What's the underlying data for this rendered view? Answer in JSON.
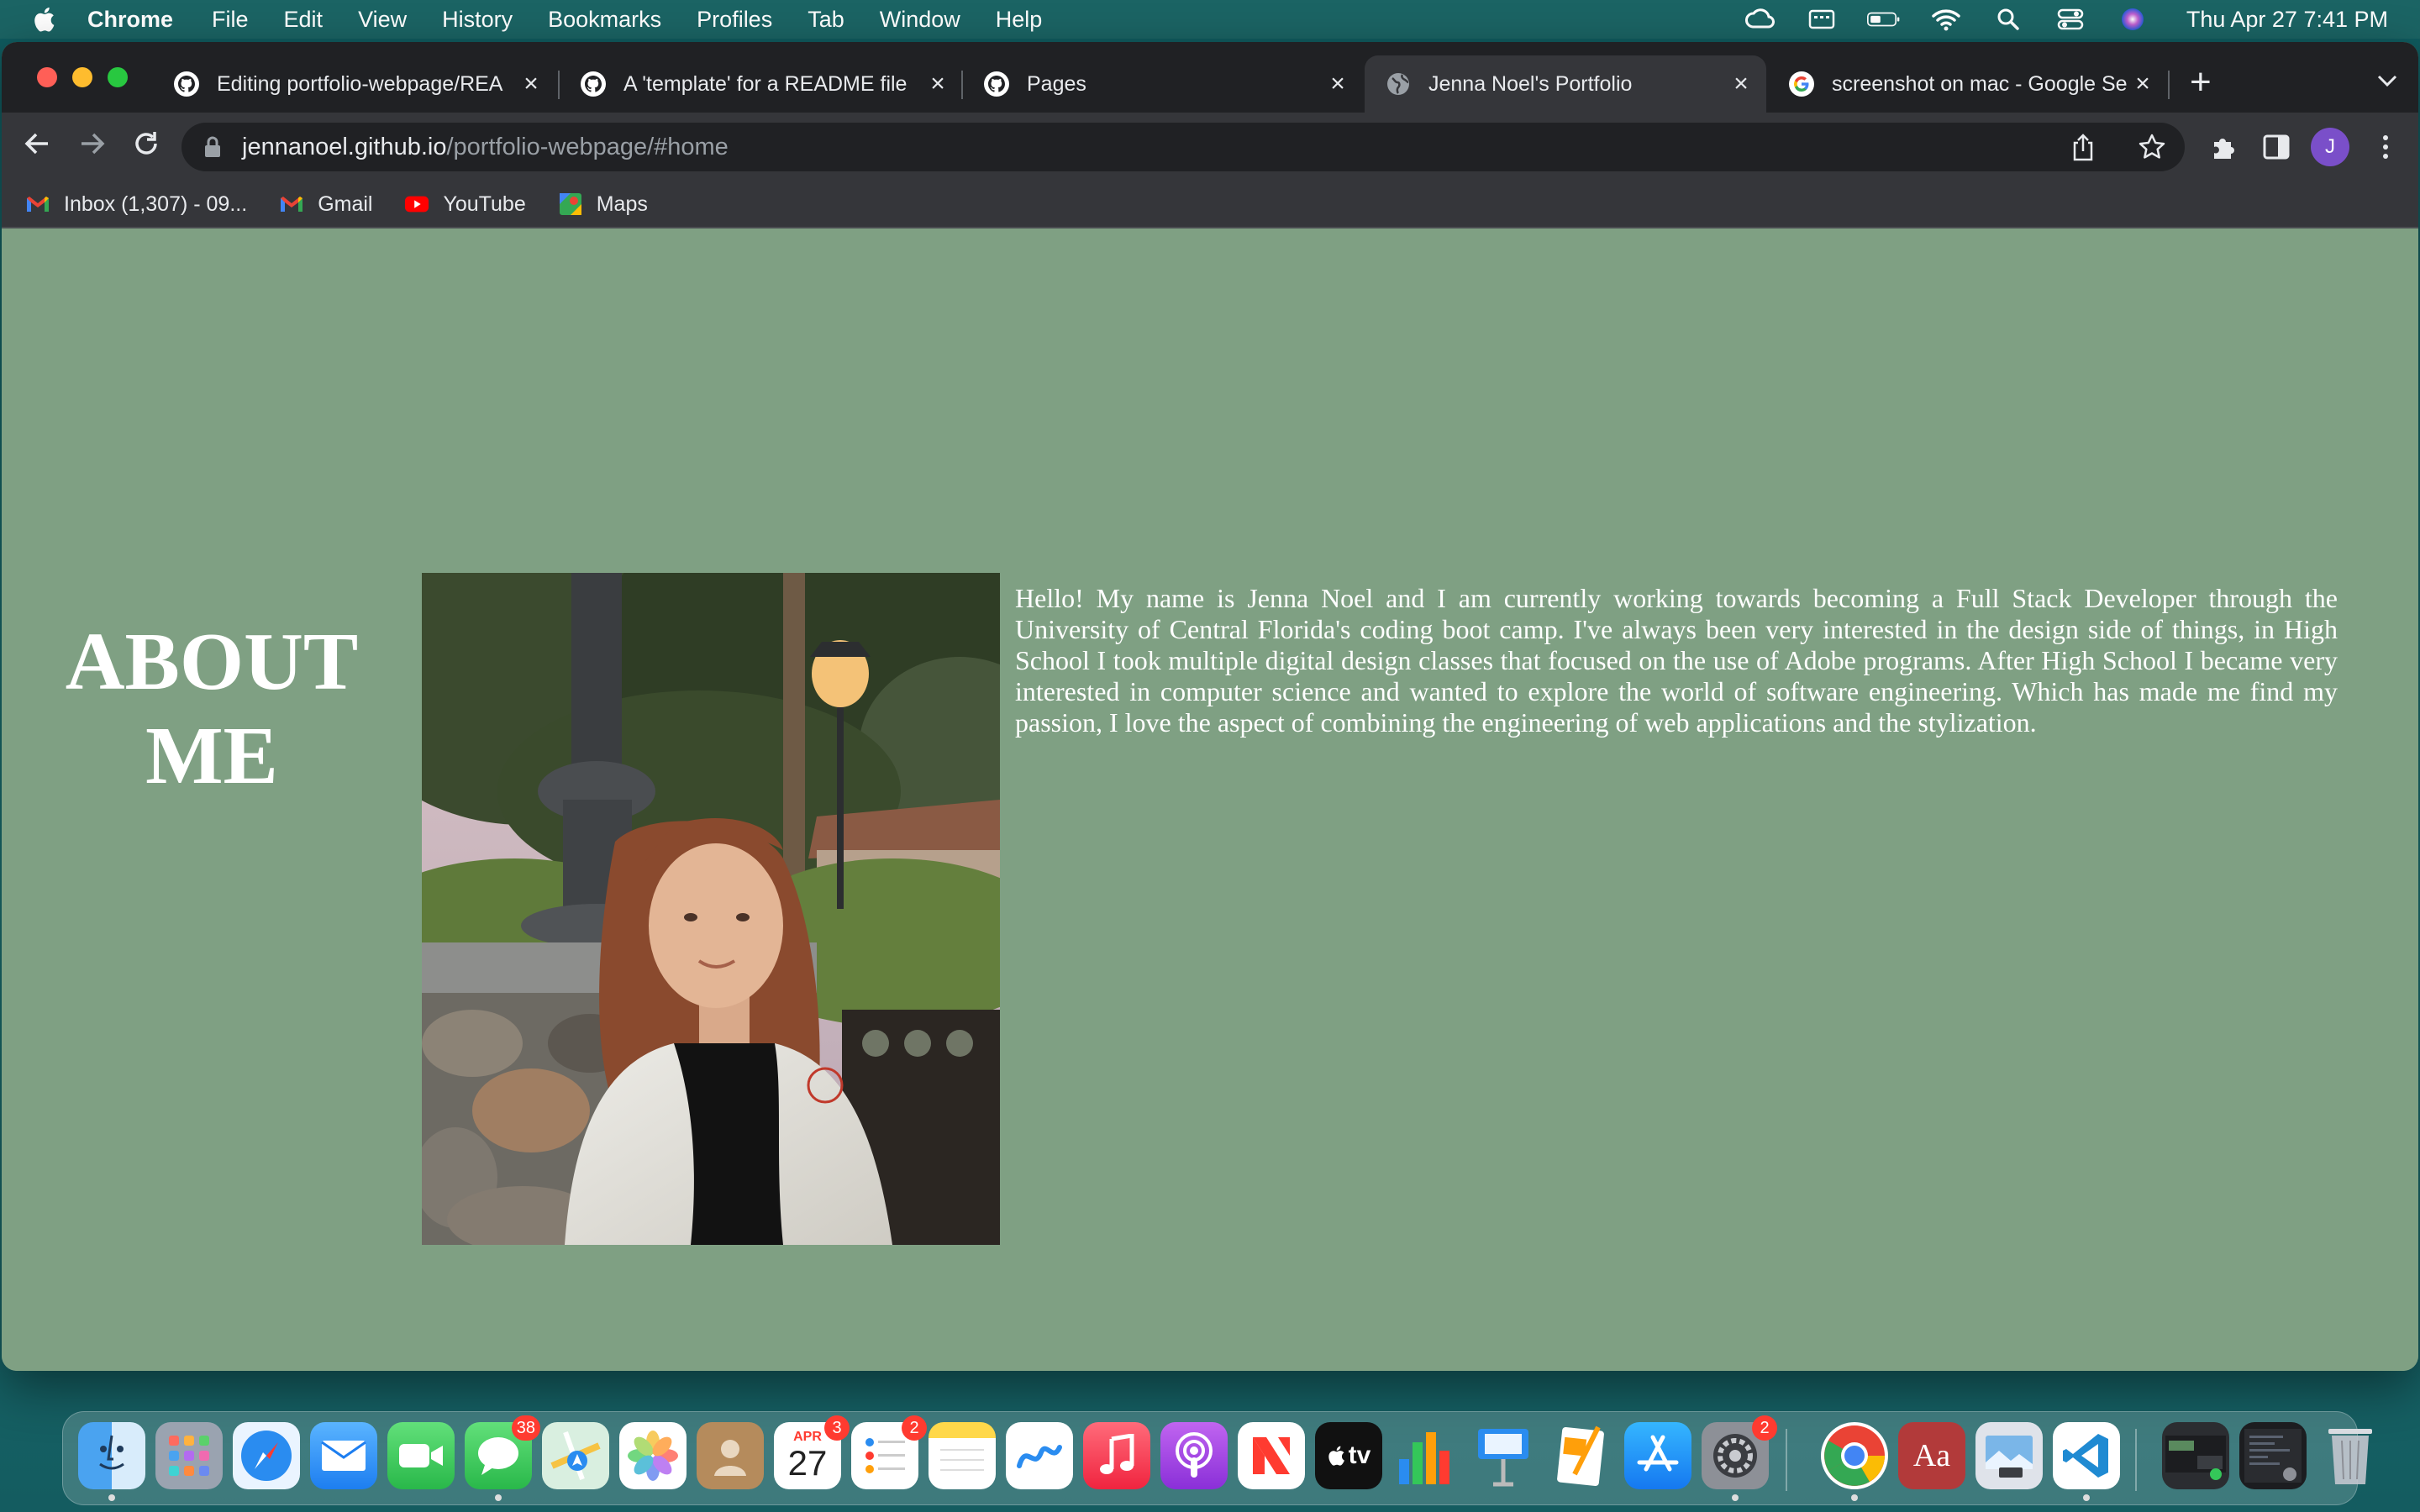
{
  "menubar": {
    "app_name": "Chrome",
    "menus": [
      "File",
      "Edit",
      "View",
      "History",
      "Bookmarks",
      "Profiles",
      "Tab",
      "Window",
      "Help"
    ],
    "clock": "Thu Apr 27  7:41 PM"
  },
  "tabs": [
    {
      "title": "Editing portfolio-webpage/REA",
      "icon": "github-icon"
    },
    {
      "title": "A 'template' for a README file",
      "icon": "github-icon"
    },
    {
      "title": "Pages",
      "icon": "github-icon"
    },
    {
      "title": "Jenna Noel's Portfolio",
      "icon": "globe-icon",
      "active": true
    },
    {
      "title": "screenshot on mac - Google Se",
      "icon": "google-icon"
    }
  ],
  "omnibox": {
    "host": "jennanoel.github.io",
    "path": "/portfolio-webpage/#home"
  },
  "avatar_letter": "J",
  "bookmarks": [
    {
      "label": "Inbox (1,307) - 09...",
      "icon": "gmail-icon"
    },
    {
      "label": "Gmail",
      "icon": "gmail-icon"
    },
    {
      "label": "YouTube",
      "icon": "youtube-icon"
    },
    {
      "label": "Maps",
      "icon": "maps-icon"
    }
  ],
  "page": {
    "heading_line1": "ABOUT",
    "heading_line2": "ME",
    "bio": "Hello! My name is Jenna Noel and I am currently working towards becoming a Full Stack Developer through the University of Central Florida's coding boot camp. I've always been very interested in the design side of things, in High School I took multiple digital design classes that focused on the use of Adobe programs. After High School I became very interested in computer science and wanted to explore the world of software engineering. Which has made me find my passion, I love the aspect of combining the engineering of web applications and the stylization.",
    "background_color": "#7fa083"
  },
  "dock": {
    "messages_badge": "38",
    "calendar_month": "APR",
    "calendar_day": "27",
    "calendar_badge": "3",
    "reminders_badge": "2",
    "settings_badge": "2",
    "tv_label": "tv",
    "dictionary_label": "Aa"
  }
}
